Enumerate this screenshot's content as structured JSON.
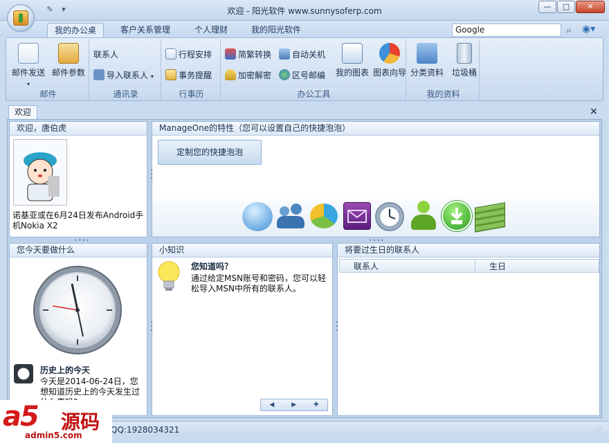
{
  "window": {
    "title": "欢迎 - 阳光软件 www.sunnysoferp.com",
    "buttons": [
      "—",
      "□",
      "✕"
    ]
  },
  "qat": {
    "icons": [
      "pin-icon",
      "dropdown-arrow-icon"
    ]
  },
  "tabs": [
    {
      "label": "我的办公桌",
      "active": true
    },
    {
      "label": "客户关系管理",
      "active": false
    },
    {
      "label": "个人理财",
      "active": false
    },
    {
      "label": "我的阳光软件",
      "active": false
    }
  ],
  "search": {
    "value": "Google"
  },
  "ribbon": {
    "mail": {
      "label": "邮件",
      "send": "邮件发送",
      "params": "邮件参数"
    },
    "contacts": {
      "label": "通讯录",
      "contact": "联系人",
      "import": "导入联系人"
    },
    "schedule": {
      "label": "行事历",
      "plan": "行程安排",
      "remind": "事务提醒"
    },
    "tools": {
      "label": "办公工具",
      "convert": "简繁转换",
      "shutdown": "自动关机",
      "encrypt": "加密解密",
      "zipcode": "区号邮编",
      "mychart": "我的图表",
      "wizard": "图表向导"
    },
    "mydata": {
      "label": "我的资料",
      "classify": "分类资料",
      "trash": "垃圾桶"
    }
  },
  "doc_tab": {
    "label": "欢迎"
  },
  "welcome": {
    "header": "欢迎，唐伯虎",
    "news": "诺基亚或在6月24日发布Android手机Nokia X2"
  },
  "features": {
    "header": "ManageOne的特性（您可以设置自己的快捷泡泡）",
    "custom_button": "定制您的快捷泡泡",
    "bubbles": [
      "chat-bubble-icon",
      "contacts-icon",
      "pie-chart-icon",
      "mail-icon",
      "clock-icon",
      "user-icon",
      "download-icon",
      "money-icon"
    ]
  },
  "today": {
    "header": "您今天要做什么",
    "history_title": "历史上的今天",
    "history_text": "今天是2014-06-24日，您想知道历史上的今天发生过什么事吗?"
  },
  "tips": {
    "header": "小知识",
    "title": "您知道吗？",
    "text": "通过给定MSN账号和密码，您可以轻松导入MSN中所有的联系人。",
    "nav": [
      "◀",
      "▶",
      "✚"
    ]
  },
  "birthdays": {
    "header": "将要过生日的联系人",
    "columns": [
      "联系人",
      "生日"
    ]
  },
  "status": {
    "qq": "QQ:1928034321"
  },
  "watermark": {
    "logo": "a5",
    "cn": "源码",
    "url": "admin5.com"
  }
}
